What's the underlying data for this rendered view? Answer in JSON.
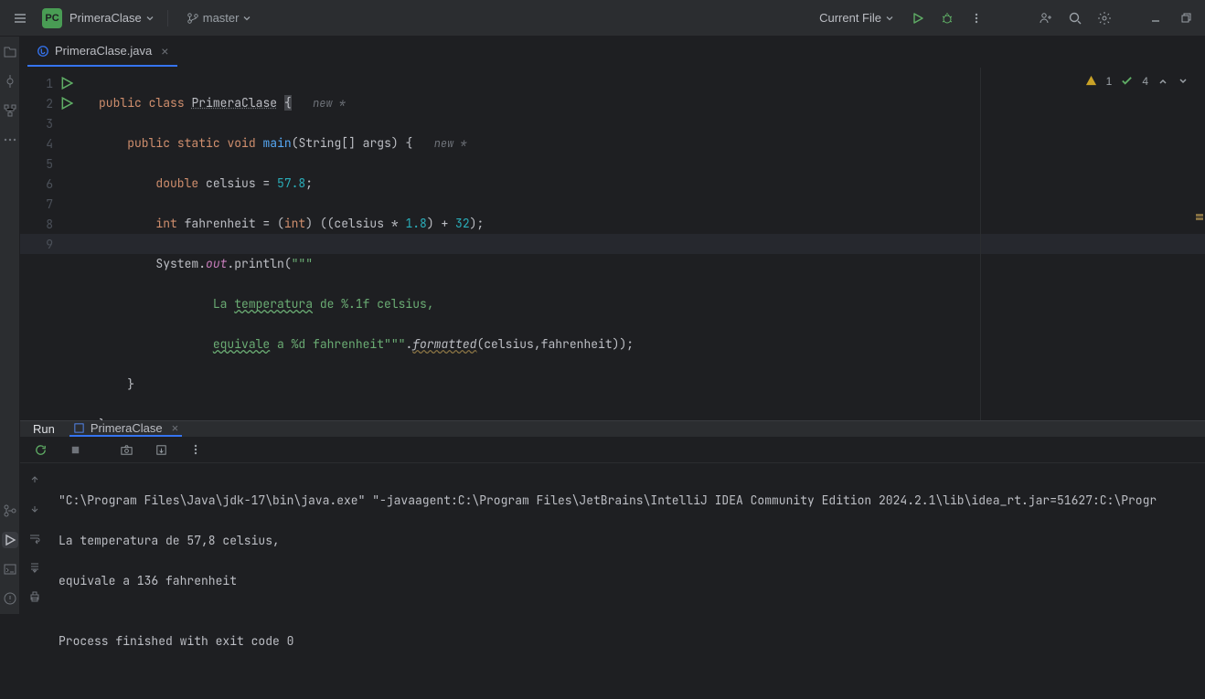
{
  "header": {
    "project_badge": "PC",
    "project_name": "PrimeraClase",
    "branch": "master",
    "run_config": "Current File"
  },
  "tabs": [
    {
      "label": "PrimeraClase.java"
    }
  ],
  "inspections": {
    "warnings": "1",
    "ok": "4"
  },
  "editor": {
    "line_numbers": [
      "1",
      "2",
      "3",
      "4",
      "5",
      "6",
      "7",
      "8",
      "9"
    ],
    "tokens": {
      "public": "public",
      "class": "class",
      "class_name": "PrimeraClase",
      "brace_open": "{",
      "hint_new": "new *",
      "static": "static",
      "void": "void",
      "main": "main",
      "params": "(String[] args) {",
      "double": "double",
      "celsius_decl": " celsius = ",
      "v578": "57.8",
      "semi": ";",
      "int": "int",
      "fahr_decl": " fahrenheit = (",
      "cast_int": "int",
      "expr_mid": ") ((celsius * ",
      "v18": "1.8",
      "expr_mid2": ") + ",
      "v32": "32",
      "expr_end": ");",
      "system": "System.",
      "out": "out",
      "println_open": ".println(",
      "triple_q": "\"\"\"",
      "str_l1a": "La ",
      "str_l1b": "temperatura",
      "str_l1c": " de %.1f celsius,",
      "str_l2a": "equivale",
      "str_l2b": " a %d fahrenheit",
      "dot": ".",
      "formatted": "formatted",
      "args_end": "(celsius,fahrenheit));",
      "brace_close_inner": "}",
      "brace_close_outer": "}"
    }
  },
  "run": {
    "title": "Run",
    "tab": "PrimeraClase",
    "console_lines": [
      "\"C:\\Program Files\\Java\\jdk-17\\bin\\java.exe\" \"-javaagent:C:\\Program Files\\JetBrains\\IntelliJ IDEA Community Edition 2024.2.1\\lib\\idea_rt.jar=51627:C:\\Progr",
      "La temperatura de 57,8 celsius,",
      "equivale a 136 fahrenheit",
      "",
      "Process finished with exit code 0"
    ]
  }
}
